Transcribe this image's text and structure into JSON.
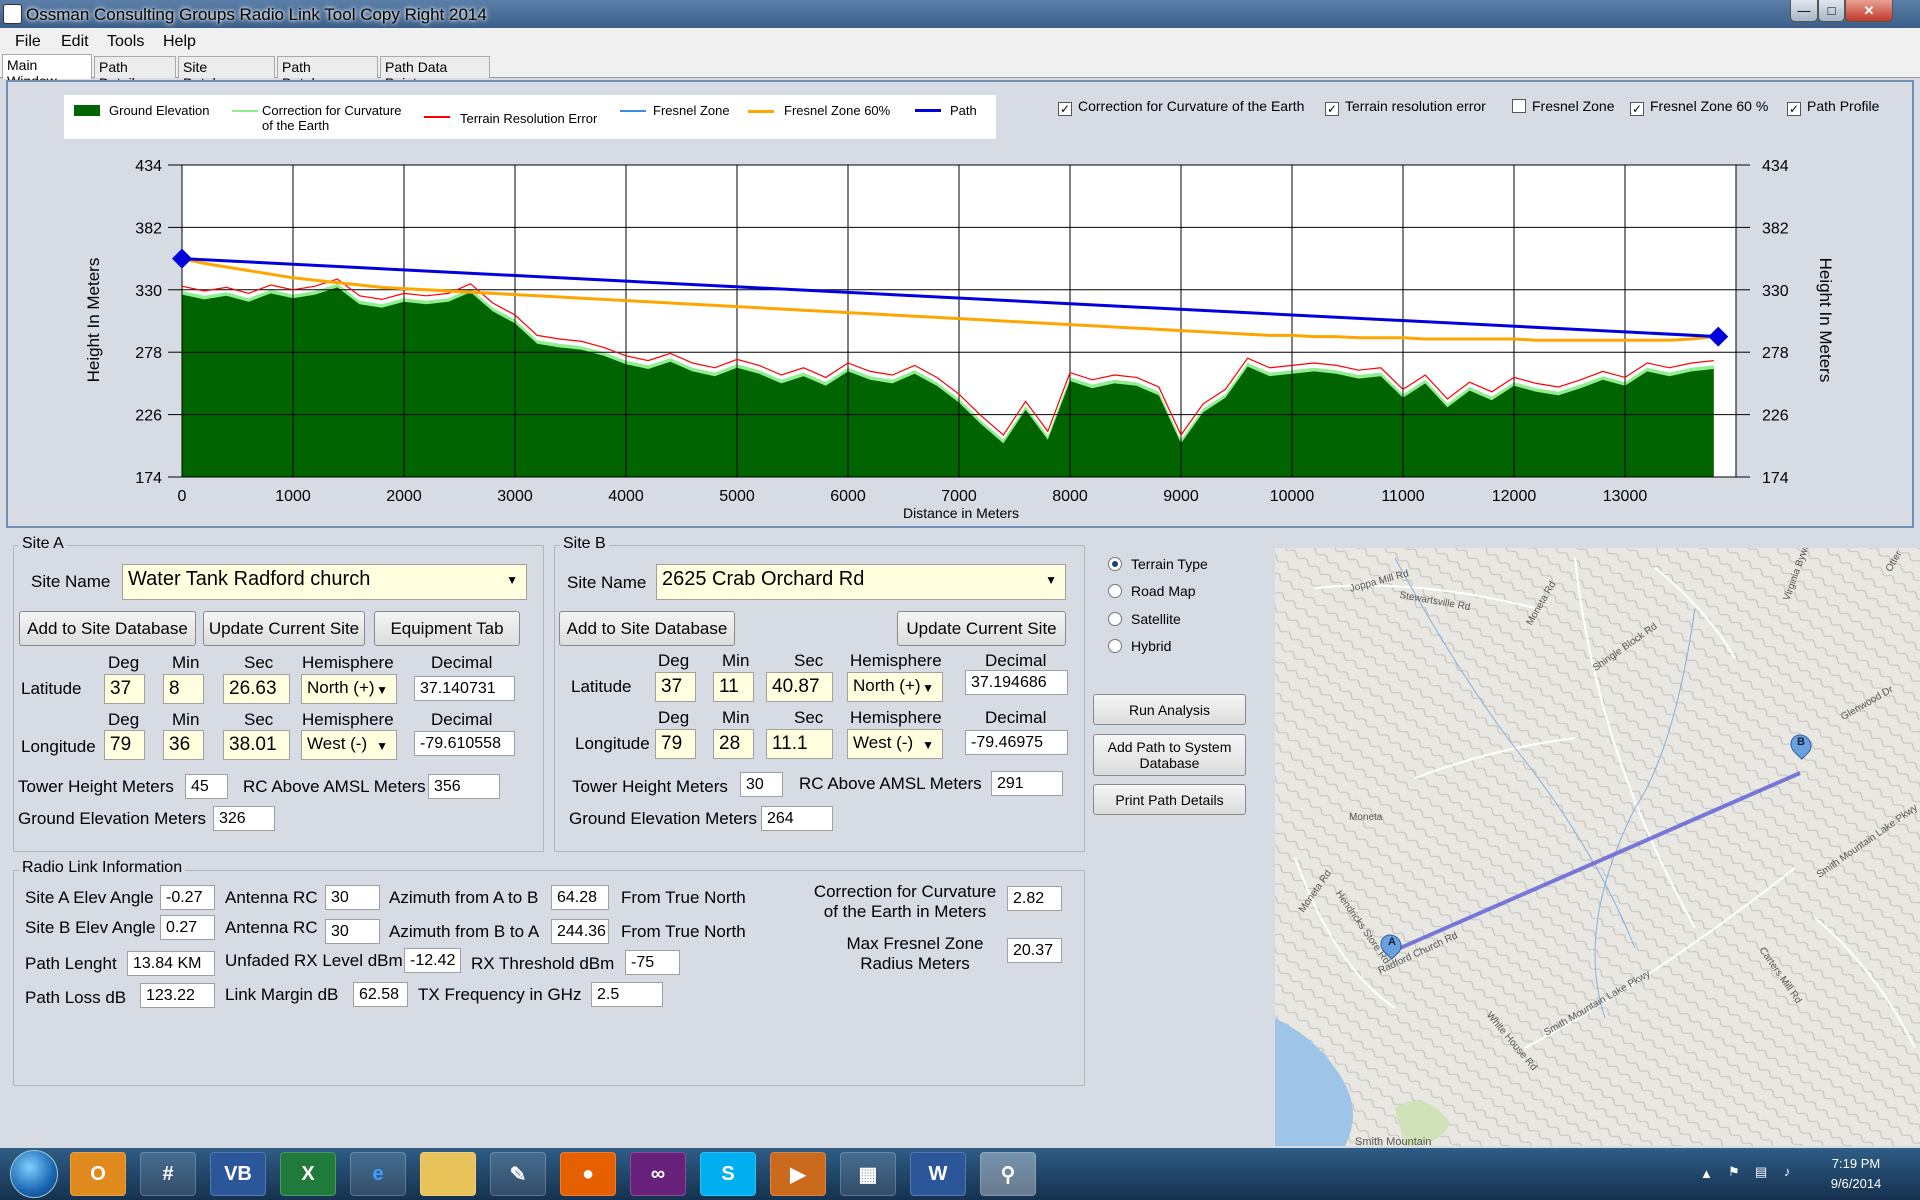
{
  "window": {
    "title": "Ossman Consulting Groups Radio Link Tool Copy Right 2014"
  },
  "menu": [
    "File",
    "Edit",
    "Tools",
    "Help"
  ],
  "tabs": [
    "Main Window",
    "Path Details",
    "Site Database",
    "Path Database",
    "Path Data Points"
  ],
  "legend": [
    "Ground Elevation",
    "Correction for Curvature of the Earth",
    "Terrain Resolution Error",
    "Fresnel Zone",
    "Fresnel Zone 60%",
    "Path"
  ],
  "options": [
    {
      "label": "Correction for Curvature of the Earth",
      "checked": true
    },
    {
      "label": "Terrain resolution error",
      "checked": true
    },
    {
      "label": "Fresnel Zone",
      "checked": false
    },
    {
      "label": "Fresnel Zone 60 %",
      "checked": true
    },
    {
      "label": "Path Profile",
      "checked": true
    }
  ],
  "chart_data": {
    "type": "area",
    "title": "",
    "xlabel": "Distance in Meters",
    "ylabel": "Height In Meters",
    "y2label": "Height In Meters",
    "xlim": [
      0,
      14000
    ],
    "ylim": [
      174,
      434
    ],
    "yticks": [
      174,
      226,
      278,
      330,
      382,
      434
    ],
    "xticks": [
      0,
      1000,
      2000,
      3000,
      4000,
      5000,
      6000,
      7000,
      8000,
      9000,
      10000,
      11000,
      12000,
      13000
    ],
    "grid": true,
    "legend_position": "top",
    "colors": {
      "ground": "#006400",
      "curvature": "#90ee90",
      "terrain_error": "#ff0000",
      "fresnel": "#3c8de0",
      "fresnel60": "#ffa500",
      "path": "#0000dd"
    },
    "x": [
      0,
      200,
      400,
      600,
      800,
      1000,
      1200,
      1400,
      1600,
      1800,
      2000,
      2200,
      2400,
      2600,
      2800,
      3000,
      3200,
      3400,
      3600,
      3800,
      4000,
      4200,
      4400,
      4600,
      4800,
      5000,
      5200,
      5400,
      5600,
      5800,
      6000,
      6200,
      6400,
      6600,
      6800,
      7000,
      7200,
      7400,
      7600,
      7800,
      8000,
      8200,
      8400,
      8600,
      8800,
      9000,
      9200,
      9400,
      9600,
      9800,
      10000,
      10200,
      10400,
      10600,
      10800,
      11000,
      11200,
      11400,
      11600,
      11800,
      12000,
      12200,
      12400,
      12600,
      12800,
      13000,
      13200,
      13400,
      13600,
      13800
    ],
    "series": [
      {
        "name": "Ground Elevation",
        "values": [
          326,
          322,
          325,
          320,
          327,
          323,
          326,
          332,
          318,
          315,
          320,
          318,
          320,
          328,
          312,
          302,
          285,
          282,
          280,
          275,
          268,
          264,
          270,
          262,
          258,
          265,
          260,
          252,
          258,
          250,
          262,
          255,
          252,
          260,
          250,
          236,
          218,
          202,
          230,
          205,
          254,
          248,
          252,
          250,
          242,
          202,
          228,
          240,
          266,
          258,
          260,
          262,
          260,
          256,
          258,
          240,
          252,
          232,
          246,
          238,
          250,
          245,
          242,
          248,
          255,
          250,
          262,
          258,
          262,
          264
        ]
      },
      {
        "name": "Terrain Resolution Error",
        "values": [
          333,
          329,
          332,
          327,
          334,
          330,
          333,
          339,
          325,
          322,
          327,
          325,
          327,
          335,
          319,
          309,
          292,
          289,
          287,
          282,
          275,
          271,
          277,
          269,
          265,
          272,
          267,
          259,
          265,
          257,
          269,
          262,
          259,
          267,
          257,
          243,
          225,
          209,
          237,
          212,
          261,
          255,
          259,
          257,
          249,
          209,
          235,
          247,
          273,
          265,
          267,
          269,
          267,
          263,
          265,
          247,
          259,
          239,
          253,
          245,
          257,
          252,
          249,
          255,
          262,
          257,
          269,
          265,
          269,
          271
        ]
      },
      {
        "name": "Fresnel Zone 60%",
        "values": [
          356,
          352,
          349,
          346,
          343,
          340,
          338,
          336,
          334,
          332,
          331,
          330,
          329,
          328,
          327,
          326,
          325,
          324,
          323,
          322,
          321,
          320,
          319,
          318,
          317,
          316,
          315,
          314,
          313,
          312,
          311,
          310,
          309,
          308,
          307,
          306,
          305,
          304,
          303,
          302,
          301,
          300,
          299,
          298,
          297,
          296,
          295,
          294,
          293,
          292,
          292,
          291,
          291,
          290,
          290,
          290,
          289,
          289,
          289,
          289,
          289,
          288,
          288,
          288,
          288,
          288,
          288,
          288,
          289,
          291
        ]
      },
      {
        "name": "Path",
        "values": [
          356,
          351
        ]
      }
    ],
    "path_endpoints": {
      "x": [
        0,
        13840
      ],
      "y": [
        356,
        291
      ]
    }
  },
  "siteA": {
    "group": "Site A",
    "name_label": "Site Name",
    "name": "Water Tank Radford church",
    "btn_add": "Add to Site Database",
    "btn_update": "Update Current Site",
    "btn_equip": "Equipment Tab",
    "hdr": {
      "deg": "Deg",
      "min": "Min",
      "sec": "Sec",
      "hem": "Hemisphere",
      "dec": "Decimal"
    },
    "lat_label": "Latitude",
    "lat_deg": "37",
    "lat_min": "8",
    "lat_sec": "26.63",
    "lat_hem": "North (+)",
    "lat_dec": "37.140731",
    "lon_label": "Longitude",
    "lon_deg": "79",
    "lon_min": "36",
    "lon_sec": "38.01",
    "lon_hem": "West (-)",
    "lon_dec": "-79.610558",
    "tower_label": "Tower Height Meters",
    "tower": "45",
    "rc_label": "RC Above AMSL Meters",
    "rc": "356",
    "ground_label": "Ground Elevation Meters",
    "ground": "326"
  },
  "siteB": {
    "group": "Site B",
    "name_label": "Site Name",
    "name": "2625 Crab Orchard Rd",
    "btn_add": "Add to Site Database",
    "btn_update": "Update Current Site",
    "hdr": {
      "deg": "Deg",
      "min": "Min",
      "sec": "Sec",
      "hem": "Hemisphere",
      "dec": "Decimal"
    },
    "lat_label": "Latitude",
    "lat_deg": "37",
    "lat_min": "11",
    "lat_sec": "40.87",
    "lat_hem": "North (+)",
    "lat_dec": "37.194686",
    "lon_label": "Longitude",
    "lon_deg": "79",
    "lon_min": "28",
    "lon_sec": "11.1",
    "lon_hem": "West (-)",
    "lon_dec": "-79.46975",
    "tower_label": "Tower Height Meters",
    "tower": "30",
    "rc_label": "RC Above AMSL Meters",
    "rc": "291",
    "ground_label": "Ground Elevation Meters",
    "ground": "264"
  },
  "radio": {
    "group": "Radio Link Information",
    "a_elev_label": "Site A Elev Angle",
    "a_elev": "-0.27",
    "a_ant_label": "Antenna RC",
    "a_ant": "30",
    "az_ab_label": "Azimuth from A to B",
    "az_ab": "64.28",
    "from_true": "From True North",
    "b_elev_label": "Site B Elev Angle",
    "b_elev": "0.27",
    "b_ant_label": "Antenna RC",
    "b_ant": "30",
    "az_ba_label": "Azimuth from B to A",
    "az_ba": "244.36",
    "path_len_label": "Path Lenght",
    "path_len": "13.84 KM",
    "rx_label": "Unfaded RX Level dBm",
    "rx": "-12.42",
    "thr_label": "RX Threshold dBm",
    "thr": "-75",
    "loss_label": "Path Loss dB",
    "loss": "123.22",
    "margin_label": "Link Margin dB",
    "margin": "62.58",
    "freq_label": "TX Frequency in GHz",
    "freq": "2.5",
    "curv_label1": "Correction for Curvature",
    "curv_label2": "of the Earth in Meters",
    "curv": "2.82",
    "fres_label1": "Max Fresnel Zone",
    "fres_label2": "Radius Meters",
    "fres": "20.37"
  },
  "maptype": {
    "options": [
      "Terrain Type",
      "Road Map",
      "Satellite",
      "Hybrid"
    ],
    "selected": "Terrain Type"
  },
  "actions": {
    "run": "Run Analysis",
    "add_path": "Add Path to System Database",
    "print": "Print Path Details"
  },
  "map": {
    "labels": [
      "Joppa Mill Rd",
      "Stewartsville Rd",
      "Moneta Rd",
      "Shingle Block Rd",
      "Glenwood Dr",
      "Moneta",
      "Moneta Rd",
      "Hendricks Store Rd",
      "Radford Church Rd",
      "Smith Mountain Lake Pkwy",
      "White House Rd",
      "Carters Mill Rd",
      "Smith Mountain Lake Pkwy",
      "Smith Mountain",
      "Virginia Byway",
      "Otter"
    ],
    "marker_a": "A",
    "marker_b": "B"
  },
  "taskbar": {
    "time": "7:19 PM",
    "date": "9/6/2014"
  }
}
